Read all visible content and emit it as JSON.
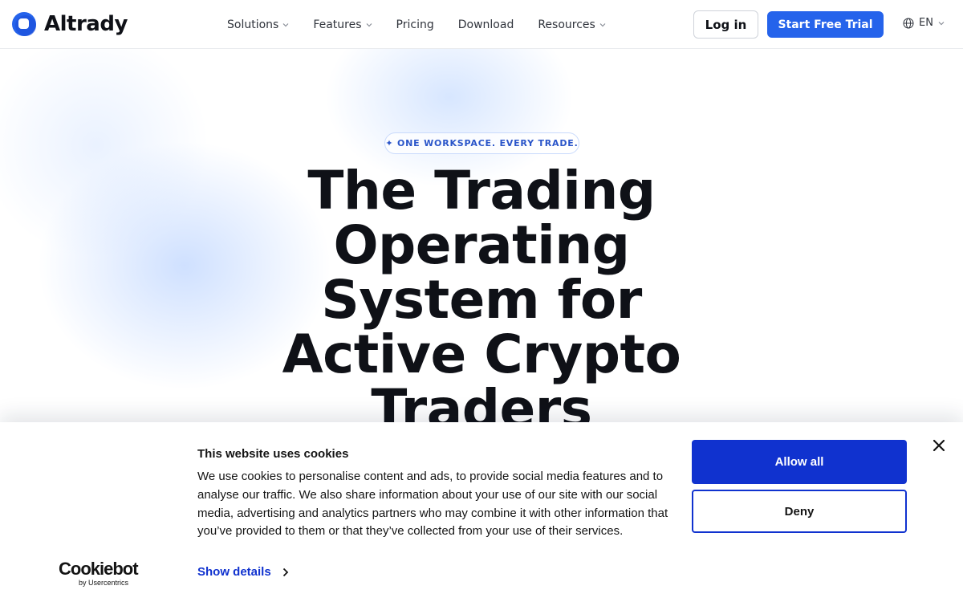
{
  "header": {
    "logo_text": "Altrady",
    "nav": [
      {
        "label": "Solutions",
        "has_dropdown": true
      },
      {
        "label": "Features",
        "has_dropdown": true
      },
      {
        "label": "Pricing",
        "has_dropdown": false
      },
      {
        "label": "Download",
        "has_dropdown": false
      },
      {
        "label": "Resources",
        "has_dropdown": true
      }
    ],
    "login_label": "Log in",
    "trial_label": "Start Free Trial",
    "language": "EN"
  },
  "hero": {
    "badge": "✦ ONE WORKSPACE. EVERY TRADE.",
    "headline_lines": [
      "The Trading",
      "Operating",
      "System for",
      "Active Crypto",
      "Traders"
    ]
  },
  "cookie_banner": {
    "title": "This website uses cookies",
    "body": "We use cookies to personalise content and ads, to provide social media features and to analyse our traffic. We also share information about your use of our site with our social media, advertising and analytics partners who may combine it with other information that you’ve provided to them or that they’ve collected from your use of their services.",
    "show_details_label": "Show details",
    "allow_label": "Allow all",
    "deny_label": "Deny",
    "brand_word": "Cookiebot",
    "brand_by": "by Usercentrics"
  },
  "colors": {
    "primary": "#2563eb",
    "cookie_blue": "#1032cf",
    "text": "#0f1117"
  }
}
